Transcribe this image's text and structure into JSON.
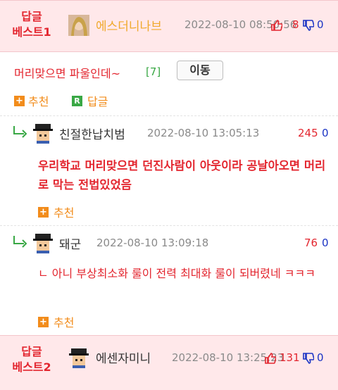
{
  "colors": {
    "best_bg": "#ffe8ea",
    "best_label": "#e3262f",
    "accent_orange": "#f28c1b",
    "green": "#39a845",
    "link_blue": "#1a33c4"
  },
  "best1": {
    "label_line1": "답글",
    "label_line2": "베스트1",
    "author": "에스더니나브",
    "date": "2022-08-10 08:50:56",
    "up_count": "8",
    "down_count": "0"
  },
  "post": {
    "title": "머리맞으면 파울인데~",
    "reply_count": "[7]",
    "move_button": "이동",
    "recommend_label": "추천",
    "reply_label": "답글",
    "r_badge": "R"
  },
  "comments": [
    {
      "author": "친절한납치범",
      "date": "2022-08-10 13:05:13",
      "up_count": "245",
      "down_count": "0",
      "text": "우리학교 머리맞으면 던진사람이 아웃이라 공날아오면 머리로 막는 전법있었음",
      "recommend_label": "추천"
    },
    {
      "author": "돼군",
      "date": "2022-08-10 13:09:18",
      "up_count": "76",
      "down_count": "0",
      "text": "ㄴ 아니 부상최소화 룰이 전력 최대화 룰이 되버렸네 ㅋㅋㅋ",
      "recommend_label": "추천"
    }
  ],
  "best2": {
    "label_line1": "답글",
    "label_line2": "베스트2",
    "author": "에센자미니",
    "date": "2022-08-10 13:25:23",
    "up_count": "131",
    "down_count": "0"
  },
  "icons": {
    "up": "thumbs-up-icon",
    "down": "thumbs-down-icon",
    "reply": "reply-arrow-icon",
    "plus": "plus-icon"
  }
}
